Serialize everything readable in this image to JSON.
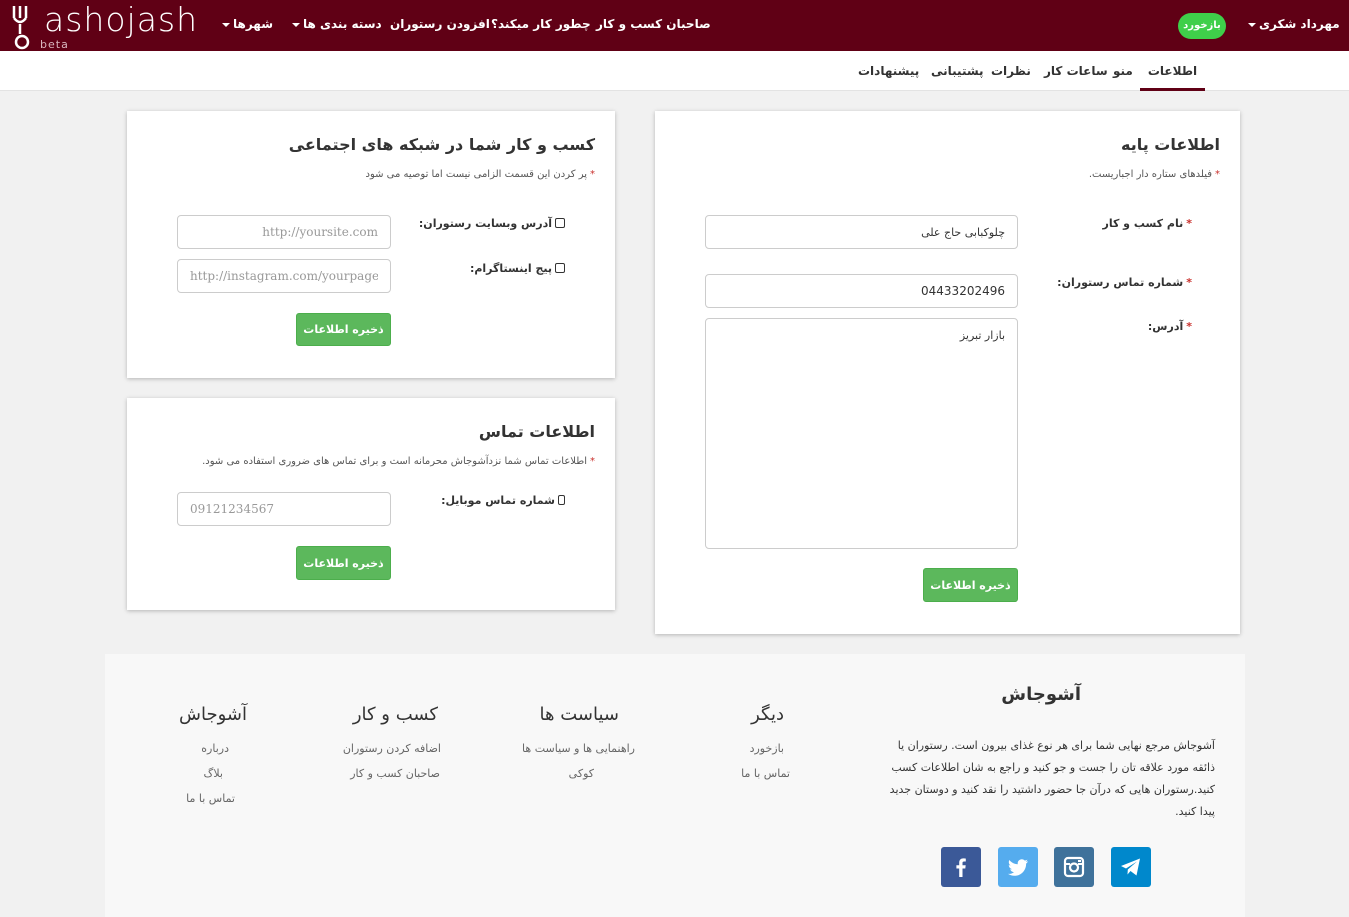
{
  "brand": {
    "logo_text": "ashojash",
    "beta": "beta"
  },
  "nav": {
    "cities": "شهرها",
    "categories": "دسته بندی ها",
    "add_restaurant": "افزودن رستوران",
    "how_it_works": "چطور کار میکند؟",
    "business_owners": "صاحبان کسب و کار",
    "login": "بازخورد",
    "user": "مهرداد شکری"
  },
  "tabs": {
    "info": "اطلاعات",
    "menu": "منو",
    "hours": "ساعات کار",
    "reviews": "نظرات",
    "support": "پشتیبانی",
    "suggestions": "پیشنهادات"
  },
  "basic": {
    "title": "اطلاعات پایه",
    "note": "فیلدهای ستاره دار اجباریست.",
    "name_label": "نام کسب و کار",
    "name_value": "چلوکبابی حاج علی",
    "phone_label": "شماره تماس رستوران:",
    "phone_value": "04433202496",
    "address_label": "آدرس:",
    "address_value": "بازار تبریز",
    "save": "ذخیره اطلاعات"
  },
  "social_card": {
    "title": "کسب و کار شما در شبکه های اجتماعی",
    "note": "پر کردن این قسمت الزامی نیست اما توصیه می شود",
    "website_label": "آدرس وبسایت رستوران:",
    "website_placeholder": "http://yoursite.com",
    "instagram_label": "پیج اینستاگرام:",
    "instagram_placeholder": "http://instagram.com/yourpage",
    "save": "ذخیره اطلاعات"
  },
  "contact": {
    "title": "اطلاعات تماس",
    "note": "اطلاعات تماس شما نزدآشوجاش محرمانه است و برای تماس های ضروری استفاده می شود.",
    "mobile_label": "شماره تماس موبایل:",
    "mobile_placeholder": "09121234567",
    "save": "ذخیره اطلاعات"
  },
  "footer": {
    "about_title": "آشوجاش",
    "about_text": "آشوجاش مرجع نهایی شما برای هر نوع غذای بیرون است. رستوران یا ذائقه مورد علاقه تان را جست و جو کنید و راجع به شان اطلاعات کسب کنید.رستوران هایی که درآن جا حضور داشتید را نقد کنید و دوستان جدید پیدا کنید.",
    "other": {
      "title": "دیگر",
      "links": [
        "بازخورد",
        "تماس با ما"
      ]
    },
    "policies": {
      "title": "سیاست ها",
      "links": [
        "راهنمایی ها و سیاست ها",
        "کوکی"
      ]
    },
    "business": {
      "title": "کسب و کار",
      "links": [
        "اضافه کردن رستوران",
        "صاحبان کسب و کار"
      ]
    },
    "ashojash": {
      "title": "آشوجاش",
      "links": [
        "درباره",
        "بلاگ",
        "تماس با ما"
      ]
    }
  },
  "colors": {
    "navbar": "#600015",
    "success": "#5cb85c",
    "login_pill": "#3fcf4a",
    "facebook": "#3b5998",
    "twitter": "#55acee",
    "instagram": "#3f729b",
    "telegram": "#0088cc"
  },
  "icons": [
    "fork-logo-icon",
    "caret-down-icon",
    "external-link-icon",
    "instagram-icon",
    "mobile-icon",
    "facebook-icon",
    "twitter-icon",
    "telegram-icon"
  ]
}
